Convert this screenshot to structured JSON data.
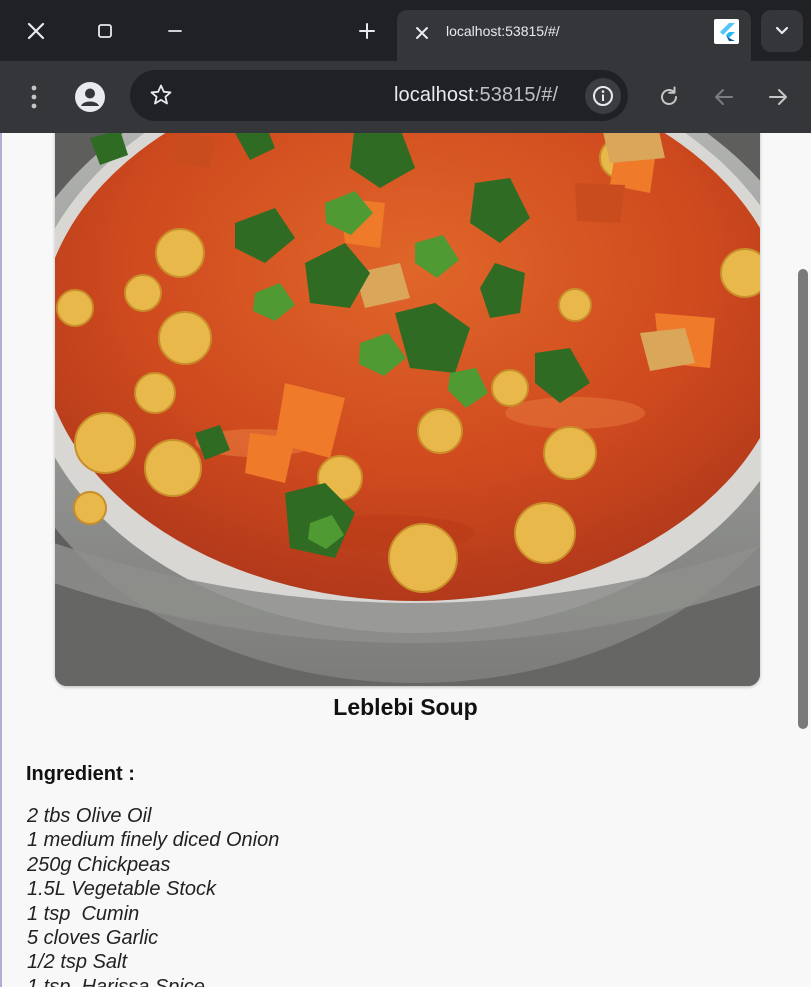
{
  "browser": {
    "tab": {
      "title": "localhost:53815/#/"
    },
    "address": {
      "host": "localhost",
      "rest": ":53815/#/"
    },
    "icons": {
      "window_close": "close-icon",
      "window_restore": "restore-icon",
      "window_minimize": "minimize-icon",
      "new_tab": "plus-icon",
      "tab_close": "close-icon",
      "favicon": "flutter-icon",
      "tab_search": "chevron-down-icon",
      "menu": "more-vert-icon",
      "profile": "person-icon",
      "bookmark": "star-icon",
      "site_info": "info-icon",
      "reload": "reload-icon",
      "back": "arrow-left-icon",
      "forward": "arrow-right-icon"
    }
  },
  "recipe": {
    "title": "Leblebi Soup",
    "ingredients_heading": "Ingredient :",
    "ingredients": [
      "2 tbs Olive Oil",
      "1 medium finely diced Onion",
      "250g Chickpeas",
      "1.5L Vegetable Stock",
      "1 tsp  Cumin",
      "5 cloves Garlic",
      "1/2 tsp Salt",
      "1 tsp  Harissa Spice"
    ]
  },
  "colors": {
    "tabbar_bg": "#202124",
    "toolbar_bg": "#35363a",
    "page_bg": "#f8f8f8",
    "soup": "#c9451c"
  }
}
